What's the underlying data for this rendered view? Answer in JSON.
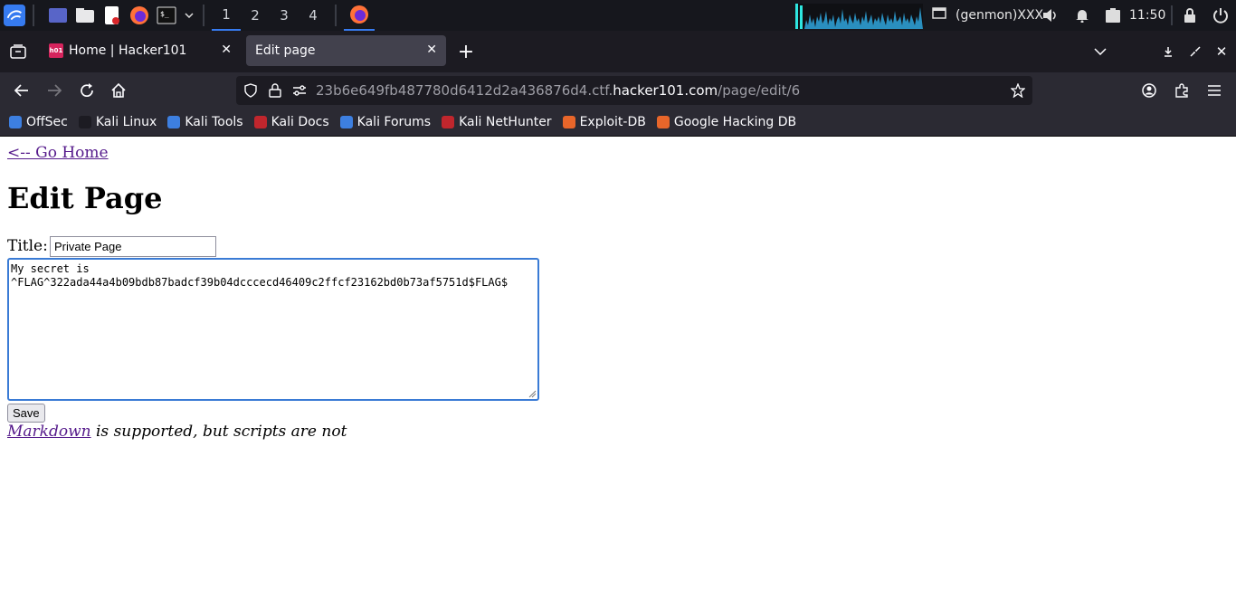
{
  "panel": {
    "workspaces": [
      "1",
      "2",
      "3",
      "4"
    ],
    "genmon": "(genmon)XXX",
    "clock": "11:50"
  },
  "browser": {
    "tabs": [
      {
        "label": "Home | Hacker101",
        "active": false
      },
      {
        "label": "Edit page",
        "active": true
      }
    ],
    "url": {
      "prefix": "23b6e649fb487780d6412d2a436876d4.ctf.",
      "host": "hacker101.com",
      "path": "/page/edit/6"
    },
    "bookmarks": [
      {
        "label": "OffSec",
        "color": "#3d7fe0"
      },
      {
        "label": "Kali Linux",
        "color": "#1c1b22"
      },
      {
        "label": "Kali Tools",
        "color": "#3d7fe0"
      },
      {
        "label": "Kali Docs",
        "color": "#c0262d"
      },
      {
        "label": "Kali Forums",
        "color": "#3d7fe0"
      },
      {
        "label": "Kali NetHunter",
        "color": "#c0262d"
      },
      {
        "label": "Exploit-DB",
        "color": "#e8662a"
      },
      {
        "label": "Google Hacking DB",
        "color": "#e8662a"
      }
    ]
  },
  "page": {
    "go_home": "<-- Go Home",
    "heading": "Edit Page",
    "title_label": "Title:",
    "title_value": "Private Page",
    "body_value": "My secret is\n^FLAG^322ada44a4b09bdb87badcf39b04dcccecd46409c2ffcf23162bd0b73af5751d$FLAG$",
    "save_label": "Save",
    "markdown_link": "Markdown",
    "markdown_note": " is supported, but scripts are not"
  }
}
